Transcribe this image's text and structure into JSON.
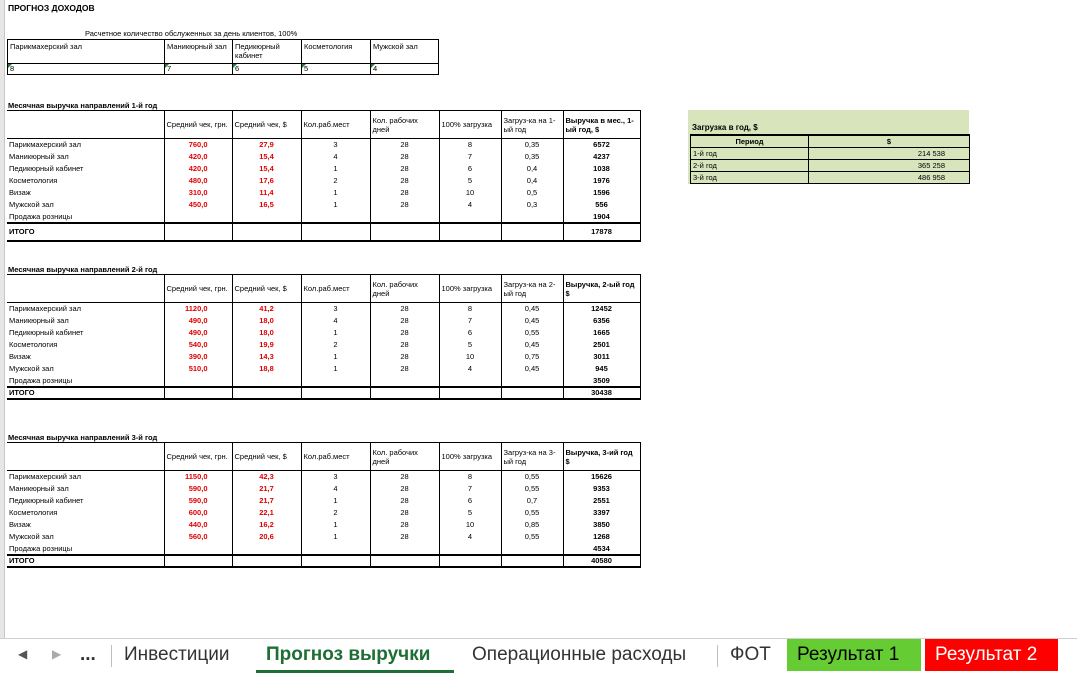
{
  "title": "ПРОГНОЗ ДОХОДОВ",
  "subtitle": "Расчетное количество обслуженных за день клиентов, 100%",
  "capacity": {
    "headers": [
      "Парикмахерский зал",
      "Маникюрный зал",
      "Педикюрный кабинет",
      "Косметология",
      "Мужской зал"
    ],
    "values": [
      "8",
      "7",
      "6",
      "5",
      "4"
    ]
  },
  "columns": {
    "name": "",
    "avg_uah": "Средний чек, грн.",
    "avg_usd": "Средний чек, $",
    "seats": "Кол.раб.мест",
    "days": "Кол. рабочих дней",
    "full": "100% загрузка"
  },
  "years": [
    {
      "heading": "Месячная выручка направлений 1-й год",
      "load_col": "Загруз-ка на 1-ый год",
      "rev_col": "Выручка в мес., 1-ый год, $",
      "rows": [
        {
          "name": "Парикмахерский зал",
          "uah": "760,0",
          "usd": "27,9",
          "seats": "3",
          "days": "28",
          "full": "8",
          "load": "0,35",
          "rev": "6572"
        },
        {
          "name": "Маникюрный зал",
          "uah": "420,0",
          "usd": "15,4",
          "seats": "4",
          "days": "28",
          "full": "7",
          "load": "0,35",
          "rev": "4237"
        },
        {
          "name": "Педикюрный кабинет",
          "uah": "420,0",
          "usd": "15,4",
          "seats": "1",
          "days": "28",
          "full": "6",
          "load": "0,4",
          "rev": "1038"
        },
        {
          "name": "Косметология",
          "uah": "480,0",
          "usd": "17,6",
          "seats": "2",
          "days": "28",
          "full": "5",
          "load": "0,4",
          "rev": "1976"
        },
        {
          "name": "Визаж",
          "uah": "310,0",
          "usd": "11,4",
          "seats": "1",
          "days": "28",
          "full": "10",
          "load": "0,5",
          "rev": "1596"
        },
        {
          "name": "Мужской зал",
          "uah": "450,0",
          "usd": "16,5",
          "seats": "1",
          "days": "28",
          "full": "4",
          "load": "0,3",
          "rev": "556"
        }
      ],
      "retail_label": "Продажа розницы",
      "retail": "1904",
      "total_label": "ИТОГО",
      "total": "17878"
    },
    {
      "heading": "Месячная выручка направлений 2-й год",
      "load_col": "Загруз-ка на 2-ый год",
      "rev_col": "Выручка, 2-ый год $",
      "rows": [
        {
          "name": "Парикмахерский зал",
          "uah": "1120,0",
          "usd": "41,2",
          "seats": "3",
          "days": "28",
          "full": "8",
          "load": "0,45",
          "rev": "12452"
        },
        {
          "name": "Маникюрный зал",
          "uah": "490,0",
          "usd": "18,0",
          "seats": "4",
          "days": "28",
          "full": "7",
          "load": "0,45",
          "rev": "6356"
        },
        {
          "name": "Педикюрный кабинет",
          "uah": "490,0",
          "usd": "18,0",
          "seats": "1",
          "days": "28",
          "full": "6",
          "load": "0,55",
          "rev": "1665"
        },
        {
          "name": "Косметология",
          "uah": "540,0",
          "usd": "19,9",
          "seats": "2",
          "days": "28",
          "full": "5",
          "load": "0,45",
          "rev": "2501"
        },
        {
          "name": "Визаж",
          "uah": "390,0",
          "usd": "14,3",
          "seats": "1",
          "days": "28",
          "full": "10",
          "load": "0,75",
          "rev": "3011"
        },
        {
          "name": "Мужской зал",
          "uah": "510,0",
          "usd": "18,8",
          "seats": "1",
          "days": "28",
          "full": "4",
          "load": "0,45",
          "rev": "945"
        }
      ],
      "retail_label": "Продажа розницы",
      "retail": "3509",
      "total_label": "ИТОГО",
      "total": "30438"
    },
    {
      "heading": "Месячная выручка направлений 3-й год",
      "load_col": "Загруз-ка на 3-ый год",
      "rev_col": "Выручка, 3-ий год $",
      "rows": [
        {
          "name": "Парикмахерский зал",
          "uah": "1150,0",
          "usd": "42,3",
          "seats": "3",
          "days": "28",
          "full": "8",
          "load": "0,55",
          "rev": "15626"
        },
        {
          "name": "Маникюрный зал",
          "uah": "590,0",
          "usd": "21,7",
          "seats": "4",
          "days": "28",
          "full": "7",
          "load": "0,55",
          "rev": "9353"
        },
        {
          "name": "Педикюрный кабинет",
          "uah": "590,0",
          "usd": "21,7",
          "seats": "1",
          "days": "28",
          "full": "6",
          "load": "0,7",
          "rev": "2551"
        },
        {
          "name": "Косметология",
          "uah": "600,0",
          "usd": "22,1",
          "seats": "2",
          "days": "28",
          "full": "5",
          "load": "0,55",
          "rev": "3397"
        },
        {
          "name": "Визаж",
          "uah": "440,0",
          "usd": "16,2",
          "seats": "1",
          "days": "28",
          "full": "10",
          "load": "0,85",
          "rev": "3850"
        },
        {
          "name": "Мужской зал",
          "uah": "560,0",
          "usd": "20,6",
          "seats": "1",
          "days": "28",
          "full": "4",
          "load": "0,55",
          "rev": "1268"
        }
      ],
      "retail_label": "Продажа розницы",
      "retail": "4534",
      "total_label": "ИТОГО",
      "total": "40580"
    }
  ],
  "load_table": {
    "title": "Загрузка в год, $",
    "period_label": "Период",
    "usd_label": "$",
    "rows": [
      {
        "period": "1-й год",
        "value": "214 538"
      },
      {
        "period": "2-й год",
        "value": "365 258"
      },
      {
        "period": "3-й год",
        "value": "486 958"
      }
    ]
  },
  "tabs": {
    "prev_icon": "◀",
    "next_icon": "▶",
    "more": "...",
    "items": [
      {
        "label": "Инвестиции",
        "style": "normal"
      },
      {
        "label": "Прогноз выручки",
        "style": "active"
      },
      {
        "label": "Операционные расходы",
        "style": "normal"
      },
      {
        "label": "ФОТ",
        "style": "normal"
      },
      {
        "label": "Результат 1",
        "style": "green"
      },
      {
        "label": "Результат 2",
        "style": "red"
      }
    ]
  }
}
